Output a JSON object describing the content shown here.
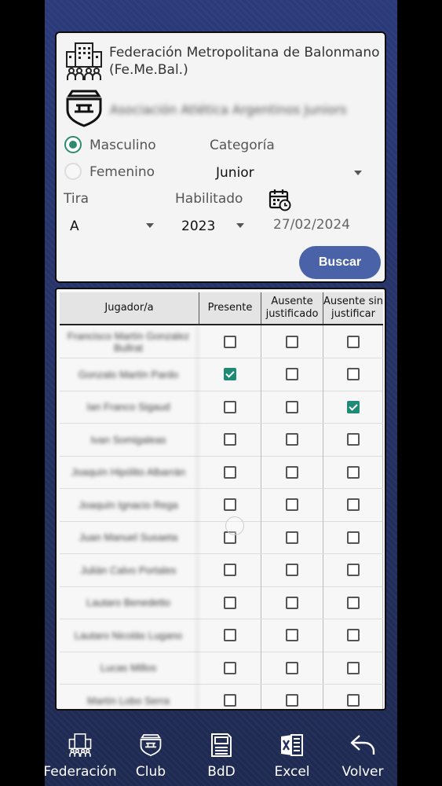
{
  "federation": {
    "name": "Federación Metropolitana de Balonmano (Fe.Me.Bal.)"
  },
  "club": {
    "name": "Asociación Atlética Argentinos Juniors"
  },
  "filters": {
    "gender_masculino": "Masculino",
    "gender_femenino": "Femenino",
    "selected_gender": "Masculino",
    "categoria_label": "Categoría",
    "categoria_value": "Junior",
    "tira_label": "Tira",
    "tira_value": "A",
    "habilitado_label": "Habilitado",
    "habilitado_value": "2023",
    "date": "27/02/2024",
    "search_button": "Buscar"
  },
  "table": {
    "headers": [
      "Jugador/a",
      "Presente",
      "Ausente justificado",
      "Ausente sin justificar"
    ],
    "rows": [
      {
        "name": "Francisco Martín Gonzalez Bullrat",
        "presente": false,
        "aus_just": false,
        "aus_sin": false
      },
      {
        "name": "Gonzalo Martín Pardo",
        "presente": true,
        "aus_just": false,
        "aus_sin": false
      },
      {
        "name": "Ian Franco Sigaud",
        "presente": false,
        "aus_just": false,
        "aus_sin": true
      },
      {
        "name": "Ivan Somigaleas",
        "presente": false,
        "aus_just": false,
        "aus_sin": false
      },
      {
        "name": "Joaquín Hipólito Albarrán",
        "presente": false,
        "aus_just": false,
        "aus_sin": false
      },
      {
        "name": "Joaquín Ignacio Rega",
        "presente": false,
        "aus_just": false,
        "aus_sin": false
      },
      {
        "name": "Juan Manuel Susaeta",
        "presente": false,
        "aus_just": false,
        "aus_sin": false
      },
      {
        "name": "Julián Calvo Portales",
        "presente": false,
        "aus_just": false,
        "aus_sin": false
      },
      {
        "name": "Lautaro Benedetto",
        "presente": false,
        "aus_just": false,
        "aus_sin": false
      },
      {
        "name": "Lautaro Nicolás Lugano",
        "presente": false,
        "aus_just": false,
        "aus_sin": false
      },
      {
        "name": "Lucas Millos",
        "presente": false,
        "aus_just": false,
        "aus_sin": false
      },
      {
        "name": "Martín Lobo Serra",
        "presente": false,
        "aus_just": false,
        "aus_sin": false
      }
    ]
  },
  "nav": {
    "items": [
      {
        "label": "Federación",
        "icon": "building-icon"
      },
      {
        "label": "Club",
        "icon": "club-shield-icon"
      },
      {
        "label": "BdD",
        "icon": "database-icon"
      },
      {
        "label": "Excel",
        "icon": "excel-icon"
      },
      {
        "label": "Volver",
        "icon": "back-arrow-icon"
      }
    ]
  },
  "colors": {
    "accent": "#2e8b6e",
    "button": "#4a62a8",
    "background": "#2b3a7a"
  }
}
